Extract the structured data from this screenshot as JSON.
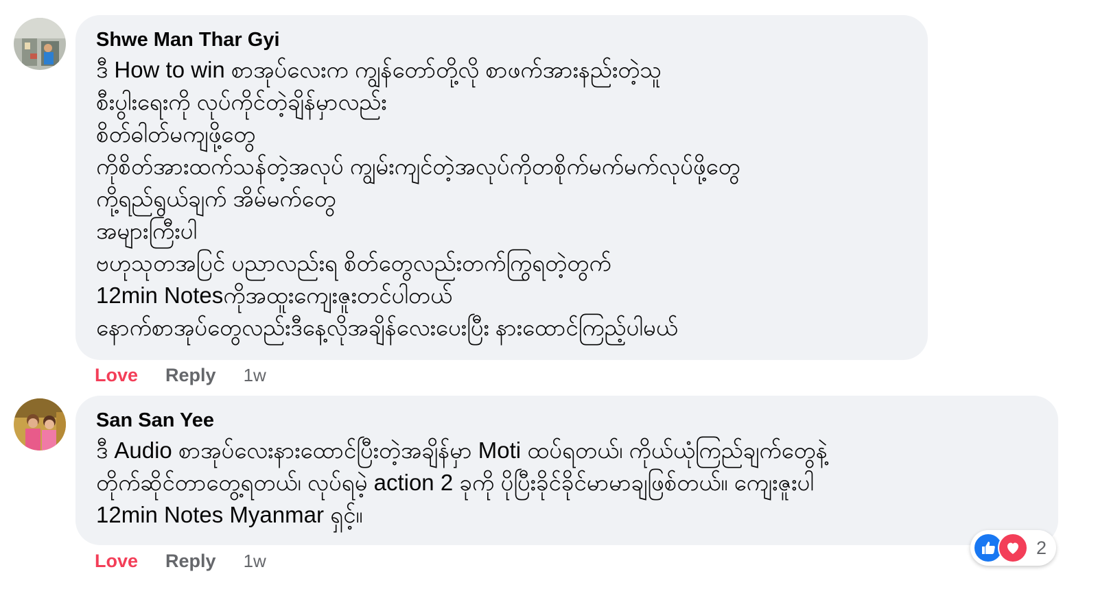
{
  "colors": {
    "bubble_bg": "#f0f2f5",
    "love_action": "#f33e58",
    "secondary_text": "#65676b",
    "like_blue": "#1877f2"
  },
  "comments": [
    {
      "author": "Shwe Man Thar Gyi",
      "lines": [
        "ဒီ How to win စာအုပ်လေးက ကျွန်တော်တို့လို စာဖက်အားနည်းတဲ့သူ",
        "စီးပွါးရေးကို လုပ်ကိုင်တဲ့ချိန်မှာလည်း",
        "စိတ်ဓါတ်မကျဖို့တွေ",
        "ကိုစိတ်အားထက်သန်တဲ့အလုပ် ကျွမ်းကျင်တဲ့အလုပ်ကိုတစိုက်မက်မက်လုပ်ဖို့တွေ",
        "ကို့ရည်ရွယ်ချက် အိမ်မက်တွေ",
        "အများကြီးပါ",
        "ဗဟုသုတအပြင် ပညာလည်းရ စိတ်တွေလည်းတက်ကြွရတဲ့တွက်",
        "12min Notesကိုအထူးကျေးဇူးတင်ပါတယ်",
        "နောက်စာအုပ်တွေလည်းဒီနေ့လိုအချိန်လေးပေးပြီး နားထောင်ကြည့်ပါမယ်"
      ],
      "actions": {
        "love": "Love",
        "reply": "Reply",
        "time": "1w"
      },
      "avatar_icon": "profile-photo"
    },
    {
      "author": "San San Yee",
      "lines": [
        "ဒီ Audio စာအုပ်လေးနားထောင်ပြီးတဲ့အချိန်မှာ Moti ထပ်ရတယ်၊ ကိုယ်ယုံကြည်ချက်တွေနဲ့",
        "တိုက်ဆိုင်တာတွေ့ရတယ်၊ လုပ်ရမဲ့ action 2 ခုကို ပိုပြီးခိုင်ခိုင်မာမာချဖြစ်တယ်။ ကျေးဇူးပါ",
        "12min Notes Myanmar ရှင့်။"
      ],
      "actions": {
        "love": "Love",
        "reply": "Reply",
        "time": "1w"
      },
      "avatar_icon": "profile-photo",
      "reactions": {
        "icons": [
          "like-icon",
          "love-icon"
        ],
        "count": "2"
      }
    }
  ]
}
